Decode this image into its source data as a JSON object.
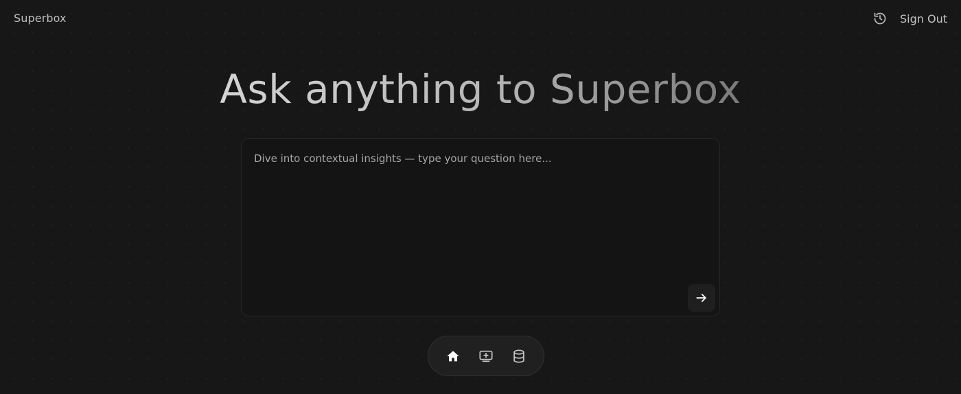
{
  "app": {
    "brand": "Superbox"
  },
  "header": {
    "history_icon": "history-icon",
    "sign_out_label": "Sign Out"
  },
  "main": {
    "headline": "Ask anything to Superbox",
    "ask": {
      "placeholder": "Dive into contextual insights — type your question here...",
      "value": "",
      "send_icon": "arrow-right-icon"
    }
  },
  "dock": {
    "items": [
      {
        "name": "home",
        "icon": "home-icon",
        "active": true
      },
      {
        "name": "add-source",
        "icon": "monitor-plus-icon",
        "active": false
      },
      {
        "name": "database",
        "icon": "database-icon",
        "active": false
      }
    ]
  },
  "colors": {
    "background": "#171717",
    "panel": "#141414",
    "dock": "#202020",
    "text_primary": "#c4c4c4",
    "placeholder": "#a7a7a7"
  }
}
